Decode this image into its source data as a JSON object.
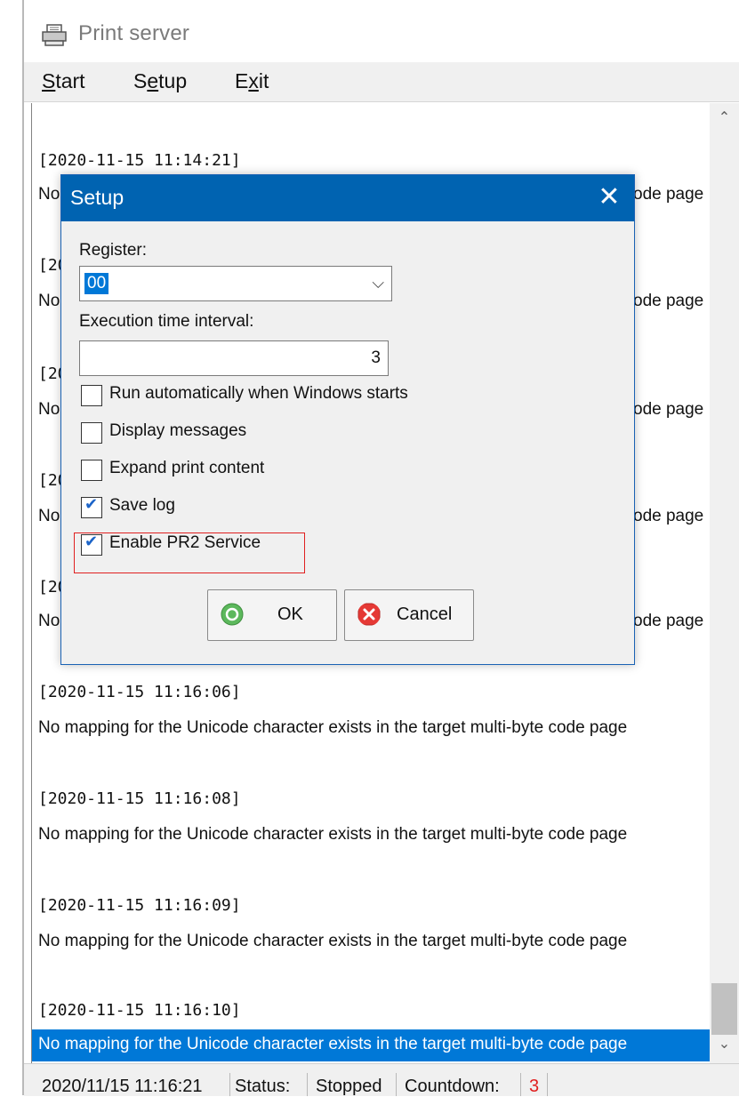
{
  "window": {
    "title": "Print server",
    "icon": "printer-icon"
  },
  "menu": [
    {
      "pre": "",
      "u": "S",
      "post": "tart"
    },
    {
      "pre": "S",
      "u": "e",
      "post": "tup"
    },
    {
      "pre": "E",
      "u": "x",
      "post": "it"
    }
  ],
  "log": {
    "entries": [
      {
        "timestamp": "[2020-11-15 11:14:21]",
        "message": "No mapping for the Unicode character exists in the target multi-byte code page"
      },
      {
        "timestamp": "[2020-11-15 11:16:06]",
        "message": "No mapping for the Unicode character exists in the target multi-byte code page"
      },
      {
        "timestamp": "[2020-11-15 11:16:08]",
        "message": "No mapping for the Unicode character exists in the target multi-byte code page"
      },
      {
        "timestamp": "[2020-11-15 11:16:09]",
        "message": "No mapping for the Unicode character exists in the target multi-byte code page"
      },
      {
        "timestamp": "[2020-11-15 11:16:10]",
        "message": "No mapping for the Unicode character exists in the target multi-byte code page"
      }
    ],
    "partial": [
      {
        "ts": "[20",
        "msg_start": "No",
        "msg_end": "ode page"
      },
      {
        "ts": "[20",
        "msg_start": "No",
        "msg_end": "ode page"
      },
      {
        "ts": "[20",
        "msg_start": "No",
        "msg_end": "ode page"
      },
      {
        "ts": "[20",
        "msg_start": "No",
        "msg_end": "ode page"
      },
      {
        "ts": "",
        "msg_start": "No",
        "msg_end": "ode page"
      }
    ]
  },
  "statusbar": {
    "datetime": "2020/11/15 11:16:21",
    "status_label": "Status:",
    "status_value": "Stopped",
    "countdown_label": "Countdown:",
    "countdown_value": "3",
    "countdown_color": "#e02020"
  },
  "dialog": {
    "title": "Setup",
    "register_label": "Register:",
    "register_value": "00",
    "interval_label": "Execution time interval:",
    "interval_value": "3",
    "checkboxes": [
      {
        "label": "Run automatically when Windows starts",
        "checked": false
      },
      {
        "label": "Display messages",
        "checked": false
      },
      {
        "label": "Expand print content",
        "checked": false
      },
      {
        "label": "Save log",
        "checked": true
      },
      {
        "label": "Enable PR2 Service",
        "checked": true
      }
    ],
    "ok_label": "OK",
    "cancel_label": "Cancel",
    "accent": "#0063b1"
  }
}
